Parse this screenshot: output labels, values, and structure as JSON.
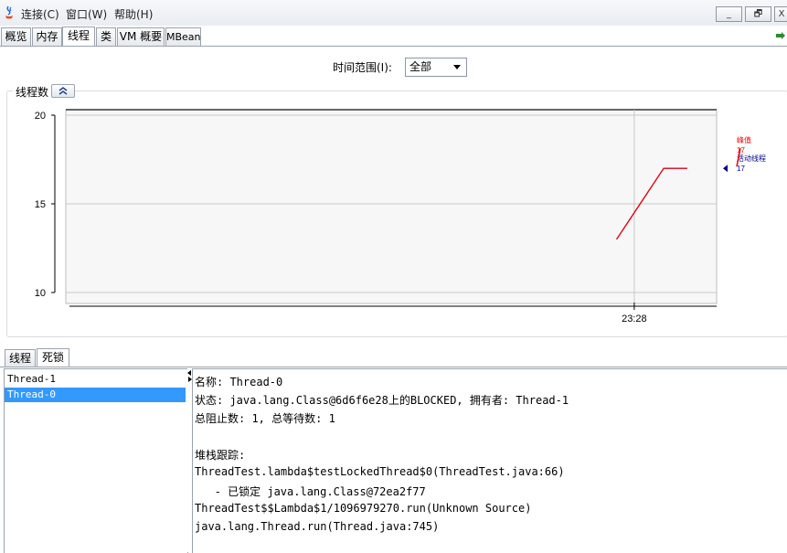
{
  "menu": {
    "items": [
      "连接(C)",
      "窗口(W)",
      "帮助(H)"
    ]
  },
  "window_controls": {
    "minimize": "_",
    "restore": "🗗",
    "close": "X"
  },
  "tabs": [
    "概览",
    "内存",
    "线程",
    "类",
    "VM 概要",
    "MBean"
  ],
  "active_tab": "线程",
  "time_range": {
    "label": "时间范围(I):",
    "value": "全部"
  },
  "threads_panel": {
    "title": "线程数"
  },
  "chart_data": {
    "type": "line",
    "x": [
      "23:27:45",
      "23:28:05",
      "23:28:25",
      "23:28:45"
    ],
    "x_tick_labels": [
      "23:28"
    ],
    "ylim": [
      10,
      20
    ],
    "y_ticks": [
      10,
      15,
      20
    ],
    "grid": true,
    "series": [
      {
        "name": "峰值",
        "values": [
          13,
          15,
          17,
          17
        ],
        "color": "#ff0000"
      },
      {
        "name": "活动线程",
        "values": [
          13,
          15,
          17,
          17
        ],
        "color": "#00008b"
      }
    ],
    "legend": {
      "placement": "right",
      "peak_label": "峰值",
      "peak_value": "17",
      "live_label": "活动线程",
      "live_value": "17"
    }
  },
  "lower_tabs": [
    "线程",
    "死锁"
  ],
  "active_lower_tab": "死锁",
  "thread_list": [
    "Thread-1",
    "Thread-0"
  ],
  "selected_thread": "Thread-0",
  "detail_lines": [
    "名称: Thread-0",
    "状态: java.lang.Class@6d6f6e28上的BLOCKED, 拥有者: Thread-1",
    "总阻止数: 1, 总等待数: 1",
    "",
    "堆栈跟踪:",
    "ThreadTest.lambda$testLockedThread$0(ThreadTest.java:66)",
    "   - 已锁定 java.lang.Class@72ea2f77",
    "ThreadTest$$Lambda$1/1096979270.run(Unknown Source)",
    "java.lang.Thread.run(Thread.java:745)"
  ]
}
